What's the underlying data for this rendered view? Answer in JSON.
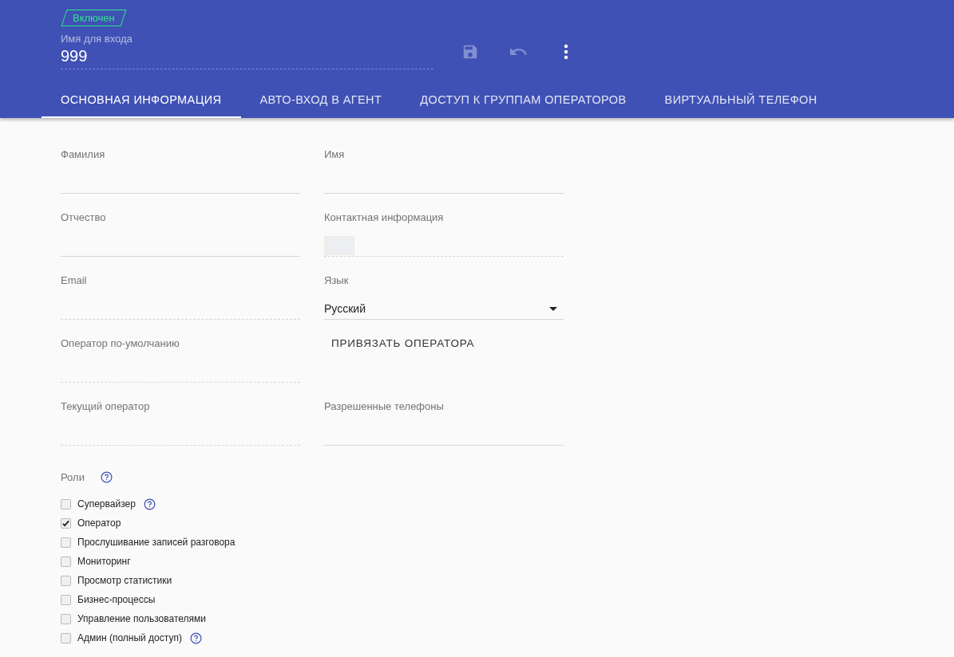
{
  "header": {
    "status_badge": "Включен",
    "login": {
      "label": "Имя для входа",
      "value": "999"
    },
    "actions": [
      {
        "kind": "save",
        "disabled": true
      },
      {
        "kind": "undo",
        "disabled": true
      },
      {
        "kind": "more",
        "disabled": false
      }
    ]
  },
  "tabs": [
    {
      "label": "ОСНОВНАЯ ИНФОРМАЦИЯ",
      "selected": true
    },
    {
      "label": "АВТО-ВХОД В АГЕНТ",
      "selected": false
    },
    {
      "label": "ДОСТУП К ГРУППАМ ОПЕРАТОРОВ",
      "selected": false
    },
    {
      "label": "ВИРТУАЛЬНЫЙ ТЕЛЕФОН",
      "selected": false
    }
  ],
  "form": {
    "rows": [
      [
        {
          "kind": "input",
          "label": "Фамилия"
        },
        {
          "kind": "input",
          "label": "Имя"
        }
      ],
      [
        {
          "kind": "input",
          "label": "Отчество"
        },
        {
          "kind": "contact",
          "label": "Контактная информация"
        }
      ],
      [
        {
          "kind": "readonly",
          "label": "Email"
        },
        {
          "kind": "select",
          "label": "Язык",
          "value": "Русский"
        }
      ],
      [
        {
          "kind": "readonly",
          "label": "Оператор по-умолчанию"
        },
        {
          "kind": "button",
          "label": "ПРИВЯЗАТЬ ОПЕРАТОРА"
        }
      ],
      [
        {
          "kind": "readonly",
          "label": "Текущий оператор"
        },
        {
          "kind": "input",
          "label": "Разрешенные телефоны"
        }
      ]
    ]
  },
  "roles": {
    "label": "Роли",
    "help": true,
    "items": [
      {
        "label": "Супервайзер",
        "checked": false,
        "help": true
      },
      {
        "label": "Оператор",
        "checked": true,
        "help": false
      },
      {
        "label": "Прослушивание записей разговора",
        "checked": false,
        "help": false
      },
      {
        "label": "Мониторинг",
        "checked": false,
        "help": false
      },
      {
        "label": "Просмотр статистики",
        "checked": false,
        "help": false
      },
      {
        "label": "Бизнес-процессы",
        "checked": false,
        "help": false
      },
      {
        "label": "Управление пользователями",
        "checked": false,
        "help": false
      },
      {
        "label": "Админ (полный доступ)",
        "checked": false,
        "help": true
      }
    ]
  }
}
